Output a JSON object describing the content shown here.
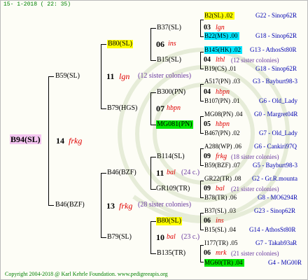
{
  "header_date": "15- 1-2018 ( 22: 35)",
  "footer": "Copyright 2004-2018 @ Karl Kehrle Foundation.   www.pedigreeapis.org",
  "root": {
    "id": "B94(SL)",
    "num": "14",
    "breed": "frkg"
  },
  "g1": [
    {
      "id": "B59(SL)",
      "num": "11",
      "breed": "lgn",
      "sis": "(12 sister colonies)"
    },
    {
      "id": "B46(BZF)",
      "num": "13",
      "breed": "frkg",
      "sis": "(28 sister colonies)"
    }
  ],
  "g2": [
    {
      "id": "B80(SL)",
      "num": "06",
      "breed": "ins"
    },
    {
      "id": "B79(HGS)",
      "num": "07",
      "breed": "hbpn"
    },
    {
      "id": "B46(BZF)",
      "num": "11",
      "breed": "bal",
      "sis": "(24 c.)"
    },
    {
      "id": "B79(SL)",
      "num": "10",
      "breed": "bal",
      "sis": "(23 c.)"
    }
  ],
  "g3": [
    {
      "id": "B37(SL)",
      "num": "03",
      "breed": "lgn"
    },
    {
      "id": "B15(SL)",
      "num": "04",
      "breed": "lthl",
      "sis": "(12 sister colonies)"
    },
    {
      "id": "B300(PN)",
      "num": "04",
      "breed": "hbpn"
    },
    {
      "id": "MG081(PN)",
      "num": "05",
      "breed": "hbpn"
    },
    {
      "id": "B114(SL)",
      "num": "09",
      "breed": "frkg",
      "sis": "(18 sister colonies)"
    },
    {
      "id": "GR109(TR)",
      "num": "09",
      "breed": "bal",
      "sis": "(21 sister colonies)"
    },
    {
      "id": "B80(SL)",
      "num": "06",
      "breed": "ins"
    },
    {
      "id": "B135(TR)",
      "num": "06",
      "breed": "mrk",
      "sis": "(21 sister colonies)"
    }
  ],
  "g4": [
    {
      "id": "B2(SL)",
      "yr": ".02",
      "ref": "G22 - Sinop62R"
    },
    {
      "id": "B22(MS)",
      "yr": ".00",
      "ref": "G18 - Sinop62R"
    },
    {
      "id": "B145(HK)",
      "yr": ".02",
      "ref": "G13 - AthosSt80R"
    },
    {
      "id": "B19(CS)",
      "yr": ".01",
      "ref": "G18 - Sinop62R"
    },
    {
      "id": "A517(PN)",
      "yr": ".03",
      "ref": "G3 - Bayburt98-3"
    },
    {
      "id": "B107(PN)",
      "yr": ".01",
      "ref": "G6 - Old_Lady"
    },
    {
      "id": "MG08(PN)",
      "yr": ".04",
      "ref": "G0 - Margret04R"
    },
    {
      "id": "B467(PN)",
      "yr": ".02",
      "ref": "G7 - Old_Lady"
    },
    {
      "id": "A288(WP)",
      "yr": ".06",
      "ref": "G6 - Cankiri97Q"
    },
    {
      "id": "B59(BZF)",
      "yr": ".07",
      "ref": "G5 - Bayburt98-3"
    },
    {
      "id": "GR22(TR)",
      "yr": ".08",
      "ref": "G2 - Gr.R.mounta"
    },
    {
      "id": "B78(TR)",
      "yr": ".06",
      "ref": "G8 - MO6294R"
    },
    {
      "id": "B37(SL)",
      "yr": ".03",
      "ref": "G23 - Sinop62R"
    },
    {
      "id": "B15(SL)",
      "yr": ".04",
      "ref": "G14 - AthosSt80R"
    },
    {
      "id": "I177(TR)",
      "yr": ".05",
      "ref": "G7 - Takab93aR"
    },
    {
      "id": "MG60(TR)",
      "yr": ".04",
      "ref": "G4 - MG00R"
    }
  ]
}
